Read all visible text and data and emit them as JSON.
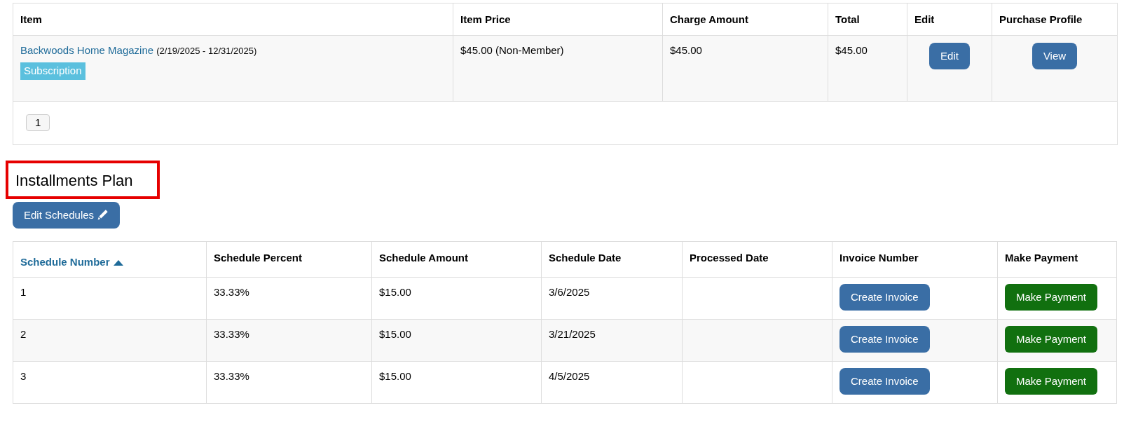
{
  "purchases": {
    "columns": [
      "Item",
      "Item Price",
      "Charge Amount",
      "Total",
      "Edit",
      "Purchase Profile"
    ],
    "rows": [
      {
        "item": "Backwoods Home Magazine",
        "dates": "(2/19/2025 - 12/31/2025)",
        "tag": "Subscription",
        "price": "$45.00 (Non-Member)",
        "charge": "$45.00",
        "total": "$45.00",
        "edit_button": "Edit",
        "profile_button": "View"
      }
    ],
    "pages": [
      "1"
    ]
  },
  "installments": {
    "title": "Installments Plan",
    "title_highlighted": true,
    "edit_button": "Edit Schedules",
    "columns": [
      {
        "label": "Schedule Number",
        "sorted": true
      },
      {
        "label": "Schedule Percent",
        "sorted": false
      },
      {
        "label": "Schedule Amount",
        "sorted": false
      },
      {
        "label": "Schedule Date",
        "sorted": false
      },
      {
        "label": "Processed Date",
        "sorted": false
      },
      {
        "label": "Invoice Number",
        "sorted": false
      },
      {
        "label": "Make Payment",
        "sorted": false
      }
    ],
    "rows": [
      {
        "number": "1",
        "percent": "33.33%",
        "amount": "$15.00",
        "date": "3/6/2025",
        "invoice_button": "Create Invoice",
        "payment_button": "Make Payment"
      },
      {
        "number": "2",
        "percent": "33.33%",
        "amount": "$15.00",
        "date": "3/21/2025",
        "invoice_button": "Create Invoice",
        "payment_button": "Make Payment"
      },
      {
        "number": "3",
        "percent": "33.33%",
        "amount": "$15.00",
        "date": "4/5/2025",
        "invoice_button": "Create Invoice",
        "payment_button": "Make Payment"
      }
    ]
  }
}
